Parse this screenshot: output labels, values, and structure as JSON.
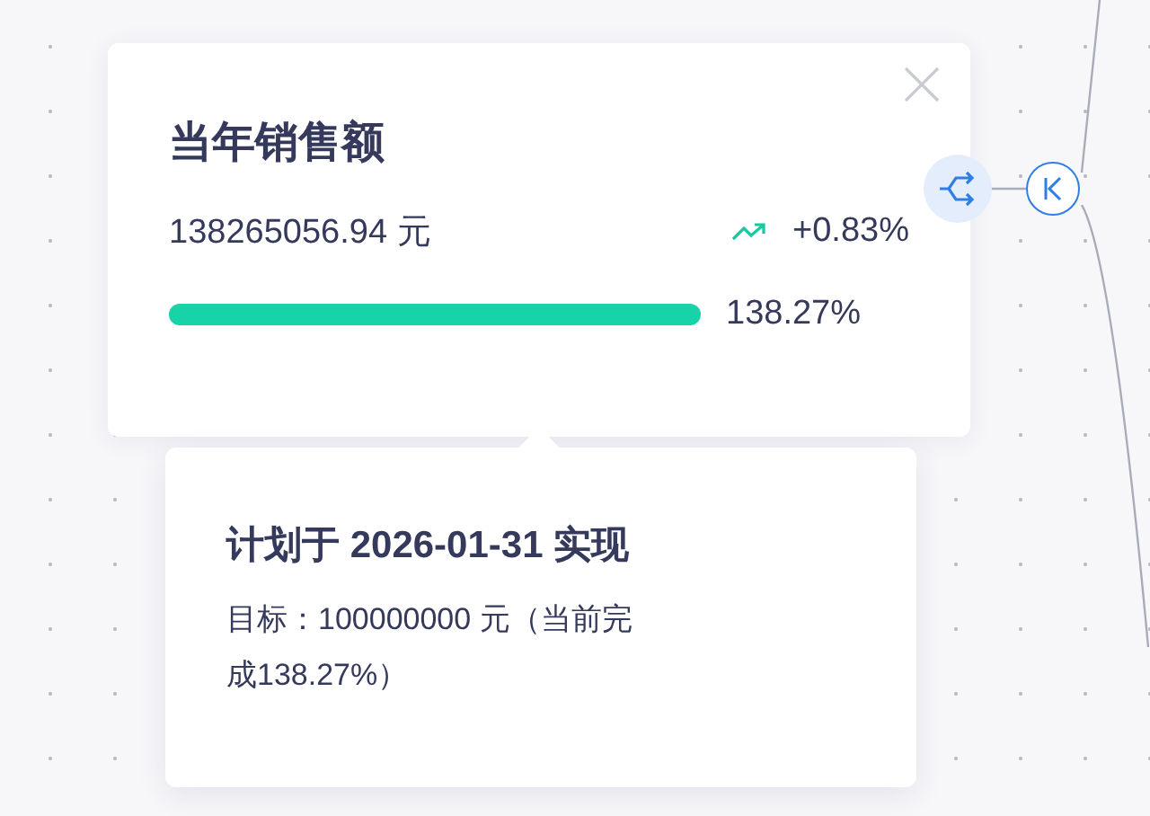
{
  "card": {
    "title": "当年销售额",
    "amount": "138265056.94 元",
    "trend": {
      "text": "+0.83%"
    },
    "progress": {
      "reading": "138.27%"
    }
  },
  "tooltip": {
    "title": "计划于 2026-01-31 实现",
    "detail": "目标：100000000 元（当前完成138.27%）"
  }
}
